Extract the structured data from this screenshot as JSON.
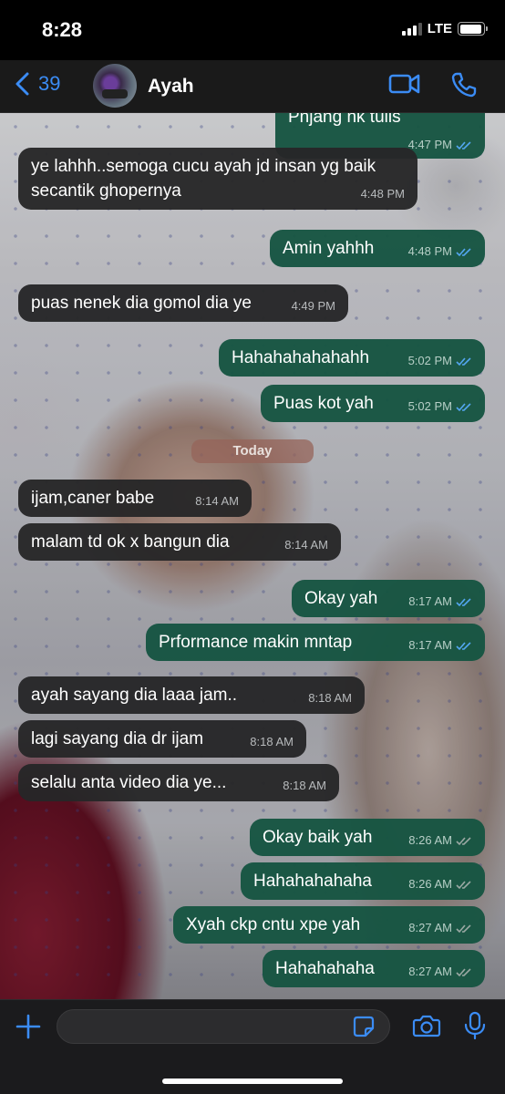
{
  "status_bar": {
    "time": "8:28",
    "network": "LTE"
  },
  "header": {
    "back_count": "39",
    "contact_name": "Ayah"
  },
  "day_separator": "Today",
  "messages": [
    {
      "dir": "out",
      "text": "Pnjang nk tulis",
      "time": "4:47 PM",
      "read": true
    },
    {
      "dir": "in",
      "text": "ye lahhh..semoga cucu ayah jd insan yg baik secantik ghopernya",
      "time": "4:48 PM"
    },
    {
      "dir": "out",
      "text": "Amin yahhh",
      "time": "4:48 PM",
      "read": true
    },
    {
      "dir": "in",
      "text": "puas nenek dia gomol dia ye",
      "time": "4:49 PM"
    },
    {
      "dir": "out",
      "text": "Hahahahahahahh",
      "time": "5:02 PM",
      "read": true
    },
    {
      "dir": "out",
      "text": "Puas kot yah",
      "time": "5:02 PM",
      "read": true
    },
    {
      "dir": "in",
      "text": "ijam,caner babe",
      "time": "8:14 AM"
    },
    {
      "dir": "in",
      "text": "malam td ok x bangun dia",
      "time": "8:14 AM"
    },
    {
      "dir": "out",
      "text": "Okay yah",
      "time": "8:17 AM",
      "read": true
    },
    {
      "dir": "out",
      "text": "Prformance makin mntap",
      "time": "8:17 AM",
      "read": true
    },
    {
      "dir": "in",
      "text": "ayah sayang dia laaa jam..",
      "time": "8:18 AM"
    },
    {
      "dir": "in",
      "text": "lagi sayang dia dr ijam",
      "time": "8:18 AM"
    },
    {
      "dir": "in",
      "text": "selalu anta video dia ye...",
      "time": "8:18 AM"
    },
    {
      "dir": "out",
      "text": "Okay baik yah",
      "time": "8:26 AM",
      "read": false
    },
    {
      "dir": "out",
      "text": "Hahahahahaha",
      "time": "8:26 AM",
      "read": false
    },
    {
      "dir": "out",
      "text": "Xyah ckp cntu xpe yah",
      "time": "8:27 AM",
      "read": false
    },
    {
      "dir": "out",
      "text": "Hahahahaha",
      "time": "8:27 AM",
      "read": false
    }
  ],
  "input": {
    "placeholder": ""
  },
  "colors": {
    "accent": "#3b8cf5",
    "read_tick": "#53a6f0",
    "delivered_tick": "#9aa8a3",
    "outgoing_bubble": "#165442",
    "incoming_bubble": "#262628"
  }
}
